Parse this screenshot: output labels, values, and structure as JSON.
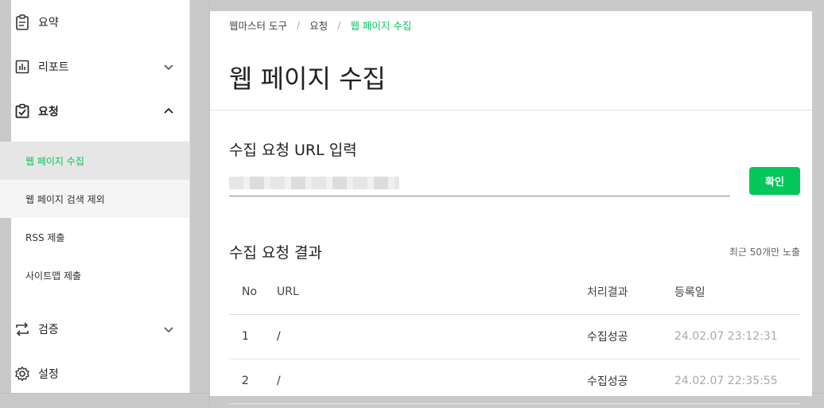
{
  "sidebar": {
    "top_item": {
      "label": "요약",
      "icon": "clipboard-icon"
    },
    "items": [
      {
        "label": "리포트",
        "icon": "bar-chart-icon",
        "chevron": "down"
      },
      {
        "label": "요청",
        "icon": "checklist-icon",
        "chevron": "up"
      },
      {
        "label": "검증",
        "icon": "repeat-icon",
        "chevron": "down"
      },
      {
        "label": "설정",
        "icon": "gear-icon"
      }
    ],
    "sub_items": [
      {
        "label": "웹 페이지 수집",
        "active": true
      },
      {
        "label": "웹 페이지 검색 제외"
      },
      {
        "label": "RSS 제출"
      },
      {
        "label": "사이트맵 제출"
      }
    ]
  },
  "breadcrumb": {
    "items": [
      "웹마스터 도구",
      "요청",
      "웹 페이지 수집"
    ],
    "separator": "/"
  },
  "page_title": "웹 페이지 수집",
  "request": {
    "title": "수집 요청 URL 입력",
    "input_value": "",
    "button_label": "확인"
  },
  "results": {
    "title": "수집 요청 결과",
    "note": "최근 50개만 노출",
    "columns": [
      "No",
      "URL",
      "처리결과",
      "등록일"
    ],
    "rows": [
      {
        "no": "1",
        "url": "/",
        "result": "수집성공",
        "date": "24.02.07 23:12:31"
      },
      {
        "no": "2",
        "url": "/",
        "result": "수집성공",
        "date": "24.02.07 22:35:55"
      }
    ]
  },
  "colors": {
    "accent": "#03c75a"
  }
}
